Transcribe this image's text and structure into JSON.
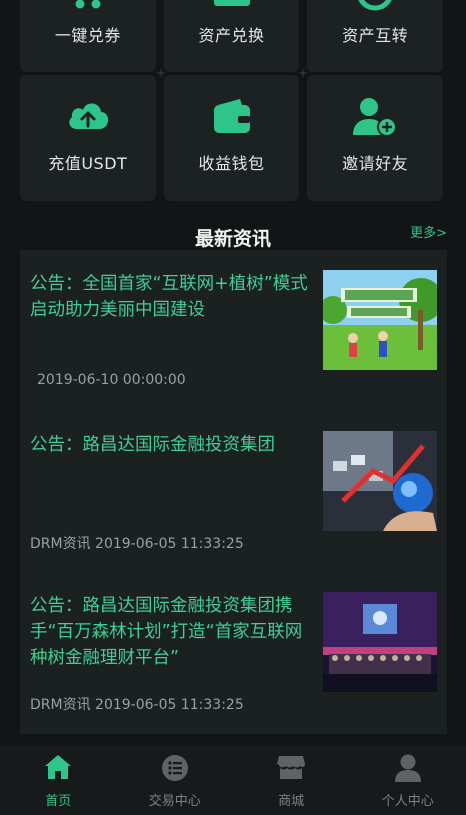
{
  "quick_row1": [
    {
      "label": "一键兑券",
      "icon": "cart-icon"
    },
    {
      "label": "资产兑换",
      "icon": "exchange-icon"
    },
    {
      "label": "资产互转",
      "icon": "transfer-icon"
    }
  ],
  "quick_row2": [
    {
      "label": "充值USDT",
      "icon": "cloud-upload-icon"
    },
    {
      "label": "收益钱包",
      "icon": "wallet-icon"
    },
    {
      "label": "邀请好友",
      "icon": "add-user-icon"
    }
  ],
  "news": {
    "title": "最新资讯",
    "more": "更多>",
    "items": [
      {
        "title": "公告：全国首家“互联网+植树”模式启动助力美丽中国建设",
        "meta": "2019-06-10 00:00:00",
        "thumb": "tree-planting-thumbnail"
      },
      {
        "title": "公告：路昌达国际金融投资集团",
        "meta": "DRM资讯  2019-06-05 11:33:25",
        "thumb": "finance-globe-thumbnail"
      },
      {
        "title": "公告：路昌达国际金融投资集团携手“百万森林计划”打造“首家互联网种树金融理财平台”",
        "meta": "DRM资讯  2019-06-05 11:33:25",
        "thumb": "event-stage-thumbnail"
      }
    ]
  },
  "tabs": [
    {
      "label": "首页",
      "icon": "home-icon",
      "active": true
    },
    {
      "label": "交易中心",
      "icon": "list-icon",
      "active": false
    },
    {
      "label": "商城",
      "icon": "store-icon",
      "active": false
    },
    {
      "label": "个人中心",
      "icon": "user-icon",
      "active": false
    }
  ],
  "colors": {
    "accent": "#2ec58a",
    "background": "#111515",
    "card": "#1c2122"
  }
}
